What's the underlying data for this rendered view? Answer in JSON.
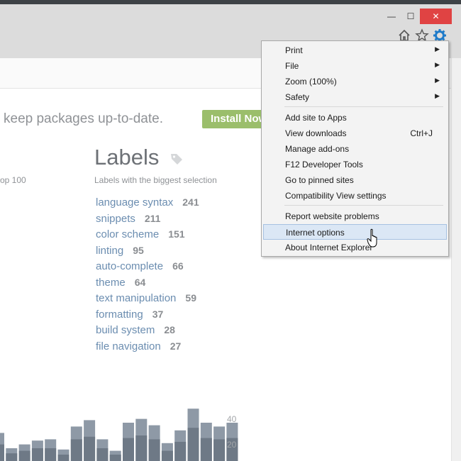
{
  "window": {
    "minimize_glyph": "—",
    "maximize_glyph": "☐",
    "close_glyph": "✕"
  },
  "toolbar_icons": [
    "home-icon",
    "star-icon",
    "gear-icon"
  ],
  "page": {
    "tagline": "keep packages up-to-date.",
    "install_button": "Install Now",
    "top_partial": "op 100",
    "labels_title": "Labels",
    "labels_subtitle": "Labels with the biggest selection",
    "labels": [
      {
        "name": "language syntax",
        "count": "241"
      },
      {
        "name": "snippets",
        "count": "211"
      },
      {
        "name": "color scheme",
        "count": "151"
      },
      {
        "name": "linting",
        "count": "95"
      },
      {
        "name": "auto-complete",
        "count": "66"
      },
      {
        "name": "theme",
        "count": "64"
      },
      {
        "name": "text manipulation",
        "count": "59"
      },
      {
        "name": "formatting",
        "count": "37"
      },
      {
        "name": "build system",
        "count": "28"
      },
      {
        "name": "file navigation",
        "count": "27"
      }
    ]
  },
  "chart_data": {
    "type": "bar",
    "y_ticks": [
      "40",
      "20"
    ],
    "ylim": [
      0,
      45
    ],
    "values": [
      22,
      10,
      13,
      16,
      17,
      9,
      27,
      32,
      17,
      8,
      30,
      33,
      28,
      14,
      24,
      41,
      30,
      27,
      30
    ],
    "dark_values": [
      13,
      6,
      8,
      10,
      10,
      5,
      17,
      19,
      10,
      5,
      18,
      20,
      17,
      8,
      15,
      26,
      18,
      17,
      18
    ],
    "colors": {
      "light": "#8e99a6",
      "dark": "#6e7986"
    }
  },
  "tools_menu": {
    "items": [
      {
        "label": "Print",
        "submenu": true
      },
      {
        "label": "File",
        "submenu": true
      },
      {
        "label": "Zoom (100%)",
        "submenu": true
      },
      {
        "label": "Safety",
        "submenu": true
      },
      {
        "label": "Add site to Apps"
      },
      {
        "label": "View downloads",
        "shortcut": "Ctrl+J"
      },
      {
        "label": "Manage add-ons"
      },
      {
        "label": "F12 Developer Tools"
      },
      {
        "label": "Go to pinned sites"
      },
      {
        "label": "Compatibility View settings"
      },
      {
        "label": "Report website problems"
      },
      {
        "label": "Internet options",
        "hovered": true
      },
      {
        "label": "About Internet Explorer"
      }
    ],
    "arrow_glyph": "▶"
  },
  "colors": {
    "close_button": "#e04343",
    "gear_icon": "#1f7bc9",
    "install_button": "#9bbe6b",
    "label_link": "#6b8db0",
    "menu_hover": "#dbe7f5"
  }
}
